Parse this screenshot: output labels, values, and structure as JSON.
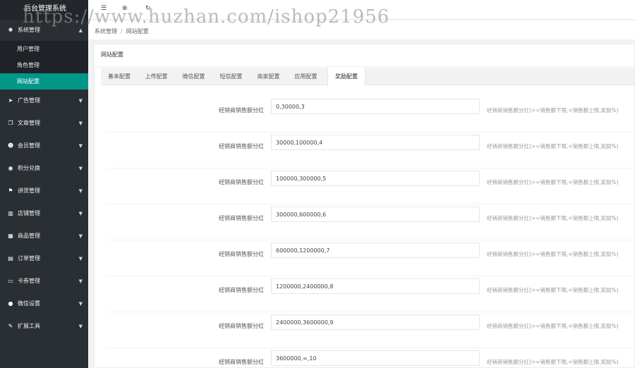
{
  "app": {
    "title": "后台管理系统",
    "watermark": "https://www.huzhan.com/ishop21956"
  },
  "topbar": {
    "icons": [
      {
        "name": "menu-toggle-icon",
        "glyph": "☰"
      },
      {
        "name": "globe-icon",
        "glyph": "⊕"
      },
      {
        "name": "refresh-icon",
        "glyph": "↻"
      }
    ]
  },
  "sidebar": {
    "items": [
      {
        "name": "sidebar-item-system",
        "label": "系统管理",
        "icon": "gear-icon",
        "glyph": "✺",
        "expanded": true
      },
      {
        "name": "sidebar-item-ads",
        "label": "广告管理",
        "icon": "send-icon",
        "glyph": "➤"
      },
      {
        "name": "sidebar-item-articles",
        "label": "文章管理",
        "icon": "copy-icon",
        "glyph": "❐"
      },
      {
        "name": "sidebar-item-members",
        "label": "会员管理",
        "icon": "users-icon",
        "glyph": "☻"
      },
      {
        "name": "sidebar-item-points",
        "label": "积分兑换",
        "icon": "eye-icon",
        "glyph": "◉"
      },
      {
        "name": "sidebar-item-dealers",
        "label": "讲货管理",
        "icon": "cart-icon",
        "glyph": "⚑"
      },
      {
        "name": "sidebar-item-stores",
        "label": "店铺管理",
        "icon": "bank-icon",
        "glyph": "▥"
      },
      {
        "name": "sidebar-item-products",
        "label": "商品管理",
        "icon": "bar-chart-icon",
        "glyph": "▦"
      },
      {
        "name": "sidebar-item-orders",
        "label": "订单管理",
        "icon": "calendar-icon",
        "glyph": "▤"
      },
      {
        "name": "sidebar-item-coupons",
        "label": "卡券管理",
        "icon": "card-icon",
        "glyph": "▭"
      },
      {
        "name": "sidebar-item-wechat",
        "label": "微信设置",
        "icon": "chat-icon",
        "glyph": "●"
      },
      {
        "name": "sidebar-item-tools",
        "label": "扩展工具",
        "icon": "wrench-icon",
        "glyph": "✎"
      }
    ],
    "submenu": [
      {
        "name": "submenu-users",
        "label": "用户管理",
        "active": false
      },
      {
        "name": "submenu-roles",
        "label": "角色管理",
        "active": false
      },
      {
        "name": "submenu-site-config",
        "label": "网站配置",
        "active": true
      }
    ]
  },
  "breadcrumb": {
    "items": [
      "系统管理",
      "网站配置"
    ],
    "separator": "/"
  },
  "panel": {
    "title": "网站配置",
    "tabs": [
      {
        "label": "基本配置",
        "active": false
      },
      {
        "label": "上传配置",
        "active": false
      },
      {
        "label": "微信配置",
        "active": false
      },
      {
        "label": "短信配置",
        "active": false
      },
      {
        "label": "商家配置",
        "active": false
      },
      {
        "label": "应用配置",
        "active": false
      },
      {
        "label": "奖励配置",
        "active": true
      }
    ],
    "rows": [
      {
        "label": "经销商销售额分红",
        "value": "0,30000,3",
        "tip": "经销商销售额分红(>=销售额下限,<销售额上限,奖励%)"
      },
      {
        "label": "经销商销售额分红",
        "value": "30000,100000,4",
        "tip": "经销商销售额分红(>=销售额下限,<销售额上限,奖励%)"
      },
      {
        "label": "经销商销售额分红",
        "value": "100000,300000,5",
        "tip": "经销商销售额分红(>=销售额下限,<销售额上限,奖励%)"
      },
      {
        "label": "经销商销售额分红",
        "value": "300000,600000,6",
        "tip": "经销商销售额分红(>=销售额下限,<销售额上限,奖励%)"
      },
      {
        "label": "经销商销售额分红",
        "value": "600000,1200000,7",
        "tip": "经销商销售额分红(>=销售额下限,<销售额上限,奖励%)"
      },
      {
        "label": "经销商销售额分红",
        "value": "1200000,2400000,8",
        "tip": "经销商销售额分红(>=销售额下限,<销售额上限,奖励%)"
      },
      {
        "label": "经销商销售额分红",
        "value": "2400000,3600000,9",
        "tip": "经销商销售额分红(>=销售额下限,<销售额上限,奖励%)"
      },
      {
        "label": "经销商销售额分红",
        "value": "3600000,∞,10",
        "tip": "经销商销售额分红(>=销售额下限,<销售额上限,奖励%)"
      }
    ]
  },
  "colors": {
    "sidebar_bg": "#2a2f34",
    "submenu_bg": "#1f2327",
    "accent": "#009688"
  }
}
